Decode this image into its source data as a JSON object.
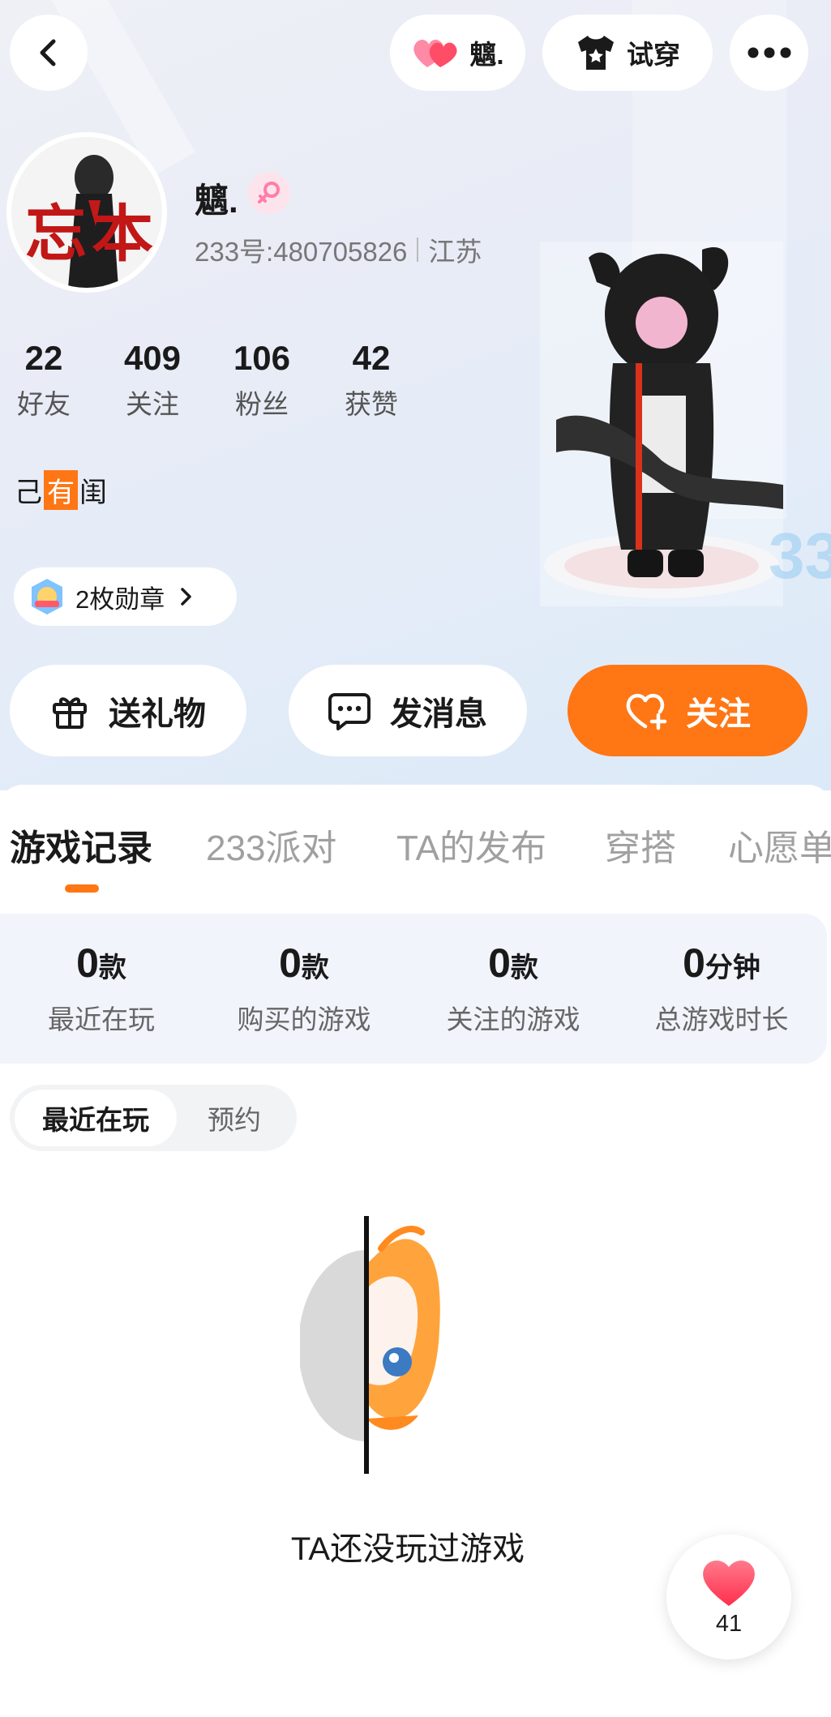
{
  "header": {
    "username_pill": "魑.",
    "tryon_label": "试穿"
  },
  "profile": {
    "avatar_text": "忘本",
    "name": "魑.",
    "id_line": "233号:480705826",
    "region": "江苏",
    "signature_pre": "己",
    "signature_tag": "有",
    "signature_post": "闺",
    "medal_label": "2枚勋章",
    "stats": [
      {
        "num": "22",
        "label": "好友"
      },
      {
        "num": "409",
        "label": "关注"
      },
      {
        "num": "106",
        "label": "粉丝"
      },
      {
        "num": "42",
        "label": "获赞"
      }
    ]
  },
  "actions": {
    "gift": "送礼物",
    "message": "发消息",
    "follow": "关注"
  },
  "tabs": [
    "游戏记录",
    "233派对",
    "TA的发布",
    "穿搭",
    "心愿单"
  ],
  "summary": [
    {
      "num": "0",
      "unit": "款",
      "label": "最近在玩"
    },
    {
      "num": "0",
      "unit": "款",
      "label": "购买的游戏"
    },
    {
      "num": "0",
      "unit": "款",
      "label": "关注的游戏"
    },
    {
      "num": "0",
      "unit": "分钟",
      "label": "总游戏时长"
    }
  ],
  "segment": {
    "recent": "最近在玩",
    "reserve": "预约"
  },
  "empty_text": "TA还没玩过游戏",
  "like_count": "41",
  "colors": {
    "accent": "#ff7614",
    "female_badge": "#ff7ea8",
    "heart": "#ff4d67"
  }
}
